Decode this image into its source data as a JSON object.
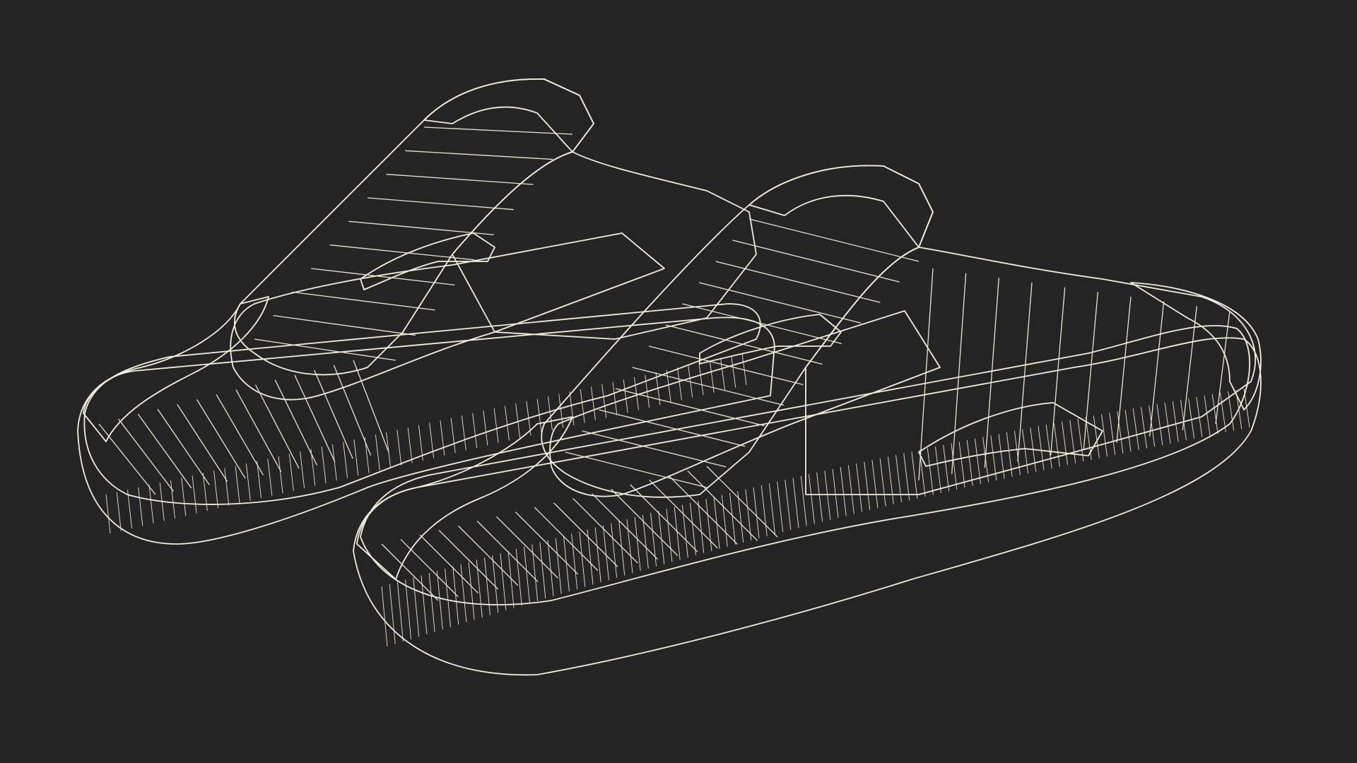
{
  "scene": {
    "subject": "slide-sandals-pair-wireframe",
    "colors": {
      "background": "#242424",
      "surface_light": "#85877a",
      "surface_mid": "#737566",
      "surface_dark": "#4f5146",
      "interior_shadow": "#3a3c33",
      "wire": "#e9e6cf"
    }
  }
}
